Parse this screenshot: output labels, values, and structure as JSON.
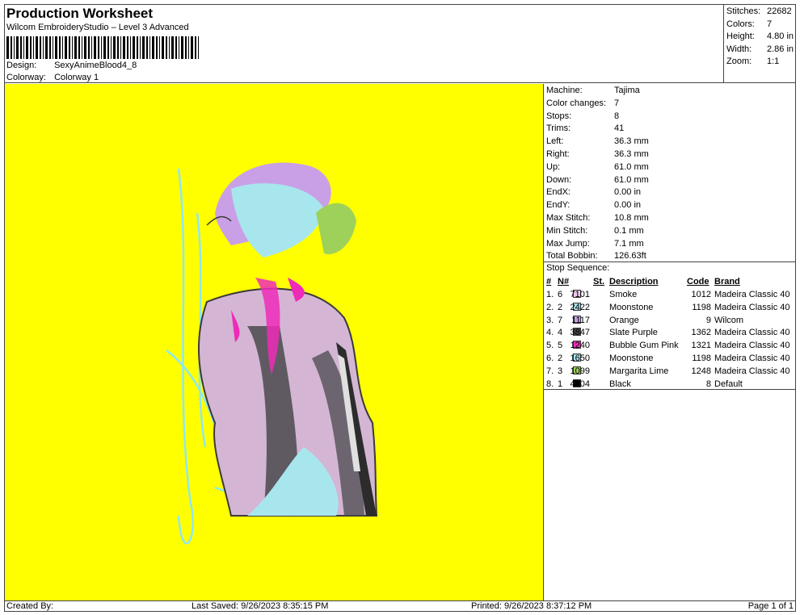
{
  "header": {
    "title": "Production Worksheet",
    "subtitle": "Wilcom EmbroideryStudio – Level 3 Advanced",
    "design_label": "Design:",
    "design_value": "SexyAnimeBlood4_8",
    "colorway_label": "Colorway:",
    "colorway_value": "Colorway 1"
  },
  "stats": [
    {
      "k": "Stitches:",
      "v": "22682"
    },
    {
      "k": "Colors:",
      "v": "7"
    },
    {
      "k": "Height:",
      "v": "4.80 in"
    },
    {
      "k": "Width:",
      "v": "2.86 in"
    },
    {
      "k": "Zoom:",
      "v": "1:1"
    }
  ],
  "machine_info": [
    {
      "k": "Machine:",
      "v": "Tajima"
    },
    {
      "k": "Color changes:",
      "v": "7"
    },
    {
      "k": "Stops:",
      "v": "8"
    },
    {
      "k": "Trims:",
      "v": "41"
    },
    {
      "k": "Left:",
      "v": "36.3 mm"
    },
    {
      "k": "Right:",
      "v": "36.3 mm"
    },
    {
      "k": "Up:",
      "v": "61.0 mm"
    },
    {
      "k": "Down:",
      "v": "61.0 mm"
    },
    {
      "k": "EndX:",
      "v": "0.00 in"
    },
    {
      "k": "EndY:",
      "v": "0.00 in"
    },
    {
      "k": "Max Stitch:",
      "v": "10.8 mm"
    },
    {
      "k": "Min Stitch:",
      "v": "0.1 mm"
    },
    {
      "k": "Max Jump:",
      "v": "7.1 mm"
    },
    {
      "k": "Total Bobbin:",
      "v": "126.63ft"
    }
  ],
  "stop_sequence": {
    "title": "Stop Sequence:",
    "headers": {
      "num": "#",
      "n": "N#",
      "st": "St.",
      "desc": "Description",
      "code": "Code",
      "brand": "Brand"
    },
    "rows": [
      {
        "num": "1.",
        "n": "6",
        "color": "#f0c8f0",
        "st": "7101",
        "desc": "Smoke",
        "code": "1012",
        "brand": "Madeira Classic 40"
      },
      {
        "num": "2.",
        "n": "2",
        "color": "#a8e6ee",
        "st": "2422",
        "desc": "Moonstone",
        "code": "1198",
        "brand": "Madeira Classic 40"
      },
      {
        "num": "3.",
        "n": "7",
        "color": "#c9a0e6",
        "st": "1117",
        "desc": "Orange",
        "code": "9",
        "brand": "Wilcom"
      },
      {
        "num": "4.",
        "n": "4",
        "color": "#4a4a4e",
        "st": "3847",
        "desc": "Slate Purple",
        "code": "1362",
        "brand": "Madeira Classic 40"
      },
      {
        "num": "5.",
        "n": "5",
        "color": "#ee2bb8",
        "st": "1240",
        "desc": "Bubble Gum Pink",
        "code": "1321",
        "brand": "Madeira Classic 40"
      },
      {
        "num": "6.",
        "n": "2",
        "color": "#a8e6ee",
        "st": "1650",
        "desc": "Moonstone",
        "code": "1198",
        "brand": "Madeira Classic 40"
      },
      {
        "num": "7.",
        "n": "3",
        "color": "#9ed15a",
        "st": "1099",
        "desc": "Margarita Lime",
        "code": "1248",
        "brand": "Madeira Classic 40"
      },
      {
        "num": "8.",
        "n": "1",
        "color": "#000000",
        "st": "4204",
        "desc": "Black",
        "code": "8",
        "brand": "Default"
      }
    ]
  },
  "footer": {
    "created_by": "Created By:",
    "last_saved": "Last Saved: 9/26/2023 8:35:15 PM",
    "printed": "Printed: 9/26/2023 8:37:12 PM",
    "page": "Page 1 of 1"
  },
  "colors": {
    "canvas_background": "#ffff00"
  }
}
